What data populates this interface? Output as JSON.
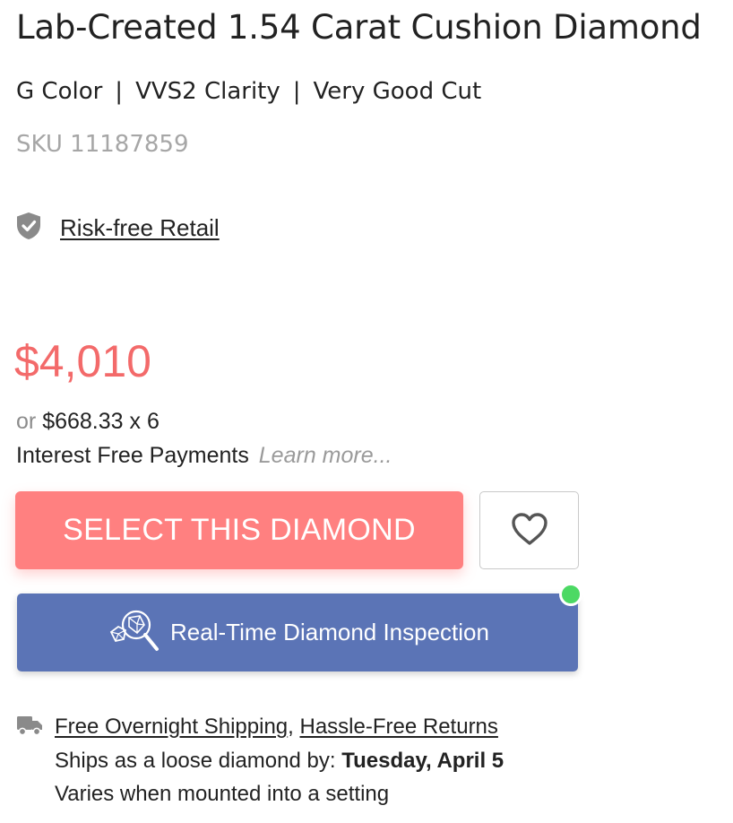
{
  "product": {
    "title": "Lab-Created 1.54 Carat Cushion Diamond",
    "specs": [
      "G Color",
      "VVS2 Clarity",
      "Very Good Cut"
    ],
    "separator": "|",
    "sku": "SKU 11187859"
  },
  "risk_free": {
    "label": "Risk-free Retail",
    "icon": "shield-check-icon"
  },
  "pricing": {
    "price": "$4,010",
    "installment_prefix": "or",
    "installment_amount": "$668.33 x 6",
    "interest_free_label": "Interest Free Payments",
    "learn_more": "Learn more..."
  },
  "actions": {
    "select_label": "SELECT THIS DIAMOND",
    "favorite_icon": "heart-icon",
    "inspection_label": "Real-Time Diamond Inspection",
    "inspection_icon": "diamond-magnifier-icon",
    "status_dot_color": "#4cd964"
  },
  "shipping": {
    "icon": "truck-icon",
    "free_shipping": "Free Overnight Shipping",
    "comma": ",",
    "returns": "Hassle-Free Returns",
    "ships_by_prefix": "Ships as a loose diamond by:",
    "ships_by_date": "Tuesday, April 5",
    "varies_note": "Varies when mounted into a setting"
  },
  "colors": {
    "price": "#f36a6a",
    "select_button": "#ff8080",
    "inspection_button": "#5b74b6"
  }
}
